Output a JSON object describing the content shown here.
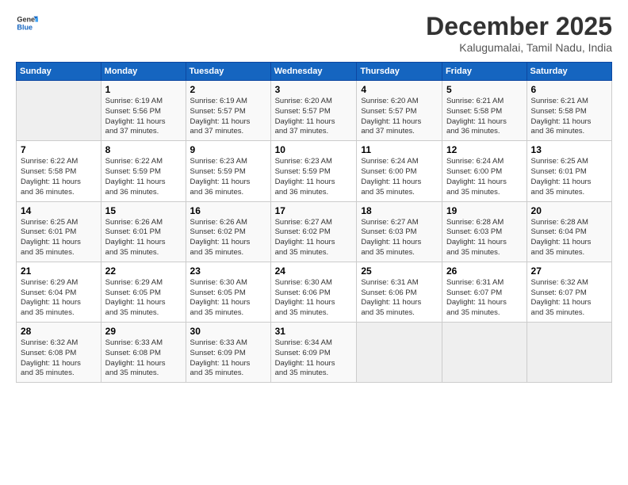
{
  "logo": {
    "line1": "General",
    "line2": "Blue"
  },
  "title": "December 2025",
  "subtitle": "Kalugumalai, Tamil Nadu, India",
  "days_header": [
    "Sunday",
    "Monday",
    "Tuesday",
    "Wednesday",
    "Thursday",
    "Friday",
    "Saturday"
  ],
  "weeks": [
    [
      {
        "num": "",
        "info": ""
      },
      {
        "num": "1",
        "info": "Sunrise: 6:19 AM\nSunset: 5:56 PM\nDaylight: 11 hours\nand 37 minutes."
      },
      {
        "num": "2",
        "info": "Sunrise: 6:19 AM\nSunset: 5:57 PM\nDaylight: 11 hours\nand 37 minutes."
      },
      {
        "num": "3",
        "info": "Sunrise: 6:20 AM\nSunset: 5:57 PM\nDaylight: 11 hours\nand 37 minutes."
      },
      {
        "num": "4",
        "info": "Sunrise: 6:20 AM\nSunset: 5:57 PM\nDaylight: 11 hours\nand 37 minutes."
      },
      {
        "num": "5",
        "info": "Sunrise: 6:21 AM\nSunset: 5:58 PM\nDaylight: 11 hours\nand 36 minutes."
      },
      {
        "num": "6",
        "info": "Sunrise: 6:21 AM\nSunset: 5:58 PM\nDaylight: 11 hours\nand 36 minutes."
      }
    ],
    [
      {
        "num": "7",
        "info": "Sunrise: 6:22 AM\nSunset: 5:58 PM\nDaylight: 11 hours\nand 36 minutes."
      },
      {
        "num": "8",
        "info": "Sunrise: 6:22 AM\nSunset: 5:59 PM\nDaylight: 11 hours\nand 36 minutes."
      },
      {
        "num": "9",
        "info": "Sunrise: 6:23 AM\nSunset: 5:59 PM\nDaylight: 11 hours\nand 36 minutes."
      },
      {
        "num": "10",
        "info": "Sunrise: 6:23 AM\nSunset: 5:59 PM\nDaylight: 11 hours\nand 36 minutes."
      },
      {
        "num": "11",
        "info": "Sunrise: 6:24 AM\nSunset: 6:00 PM\nDaylight: 11 hours\nand 35 minutes."
      },
      {
        "num": "12",
        "info": "Sunrise: 6:24 AM\nSunset: 6:00 PM\nDaylight: 11 hours\nand 35 minutes."
      },
      {
        "num": "13",
        "info": "Sunrise: 6:25 AM\nSunset: 6:01 PM\nDaylight: 11 hours\nand 35 minutes."
      }
    ],
    [
      {
        "num": "14",
        "info": "Sunrise: 6:25 AM\nSunset: 6:01 PM\nDaylight: 11 hours\nand 35 minutes."
      },
      {
        "num": "15",
        "info": "Sunrise: 6:26 AM\nSunset: 6:01 PM\nDaylight: 11 hours\nand 35 minutes."
      },
      {
        "num": "16",
        "info": "Sunrise: 6:26 AM\nSunset: 6:02 PM\nDaylight: 11 hours\nand 35 minutes."
      },
      {
        "num": "17",
        "info": "Sunrise: 6:27 AM\nSunset: 6:02 PM\nDaylight: 11 hours\nand 35 minutes."
      },
      {
        "num": "18",
        "info": "Sunrise: 6:27 AM\nSunset: 6:03 PM\nDaylight: 11 hours\nand 35 minutes."
      },
      {
        "num": "19",
        "info": "Sunrise: 6:28 AM\nSunset: 6:03 PM\nDaylight: 11 hours\nand 35 minutes."
      },
      {
        "num": "20",
        "info": "Sunrise: 6:28 AM\nSunset: 6:04 PM\nDaylight: 11 hours\nand 35 minutes."
      }
    ],
    [
      {
        "num": "21",
        "info": "Sunrise: 6:29 AM\nSunset: 6:04 PM\nDaylight: 11 hours\nand 35 minutes."
      },
      {
        "num": "22",
        "info": "Sunrise: 6:29 AM\nSunset: 6:05 PM\nDaylight: 11 hours\nand 35 minutes."
      },
      {
        "num": "23",
        "info": "Sunrise: 6:30 AM\nSunset: 6:05 PM\nDaylight: 11 hours\nand 35 minutes."
      },
      {
        "num": "24",
        "info": "Sunrise: 6:30 AM\nSunset: 6:06 PM\nDaylight: 11 hours\nand 35 minutes."
      },
      {
        "num": "25",
        "info": "Sunrise: 6:31 AM\nSunset: 6:06 PM\nDaylight: 11 hours\nand 35 minutes."
      },
      {
        "num": "26",
        "info": "Sunrise: 6:31 AM\nSunset: 6:07 PM\nDaylight: 11 hours\nand 35 minutes."
      },
      {
        "num": "27",
        "info": "Sunrise: 6:32 AM\nSunset: 6:07 PM\nDaylight: 11 hours\nand 35 minutes."
      }
    ],
    [
      {
        "num": "28",
        "info": "Sunrise: 6:32 AM\nSunset: 6:08 PM\nDaylight: 11 hours\nand 35 minutes."
      },
      {
        "num": "29",
        "info": "Sunrise: 6:33 AM\nSunset: 6:08 PM\nDaylight: 11 hours\nand 35 minutes."
      },
      {
        "num": "30",
        "info": "Sunrise: 6:33 AM\nSunset: 6:09 PM\nDaylight: 11 hours\nand 35 minutes."
      },
      {
        "num": "31",
        "info": "Sunrise: 6:34 AM\nSunset: 6:09 PM\nDaylight: 11 hours\nand 35 minutes."
      },
      {
        "num": "",
        "info": ""
      },
      {
        "num": "",
        "info": ""
      },
      {
        "num": "",
        "info": ""
      }
    ]
  ]
}
